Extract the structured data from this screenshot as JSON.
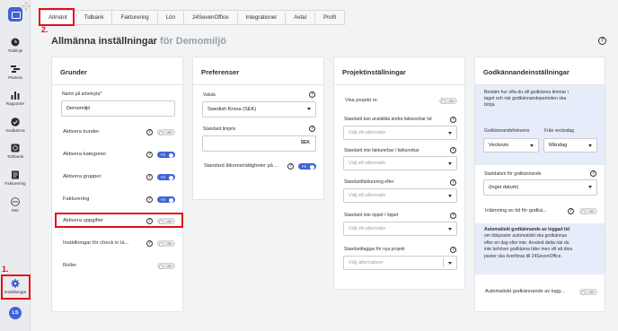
{
  "sidebar": {
    "items": [
      {
        "label": "Tidslinje",
        "icon": "clock-icon"
      },
      {
        "label": "Planera",
        "icon": "planning-icon"
      },
      {
        "label": "Rapporter",
        "icon": "bar-chart-icon"
      },
      {
        "label": "Godkänna",
        "icon": "check-circle-icon"
      },
      {
        "label": "Tidsbank",
        "icon": "timebank-icon"
      },
      {
        "label": "Fakturering",
        "icon": "invoice-icon"
      },
      {
        "label": "Mer",
        "icon": "more-icon"
      }
    ],
    "settings_label": "Inställningar",
    "avatar": "LS"
  },
  "tabs": [
    "Allmänt",
    "Tidbank",
    "Fakturering",
    "Lön",
    "24SevenOffice",
    "Integrationer",
    "Avtal",
    "Profil"
  ],
  "annotations": {
    "one": "1.",
    "two": "2."
  },
  "page": {
    "title": "Allmänna inställningar",
    "subtitle": "för Demomiljö"
  },
  "grunder": {
    "title": "Grunder",
    "workspace_label": "Namn på arbetsyta*",
    "workspace_value": "Demomiljö",
    "rows": [
      {
        "label": "Aktivera kunder",
        "state": "AV",
        "on": false
      },
      {
        "label": "Aktivera kategorier",
        "state": "PÅ",
        "on": true
      },
      {
        "label": "Aktivera grupper",
        "state": "PÅ",
        "on": true
      },
      {
        "label": "Fakturering",
        "state": "PÅ",
        "on": true
      },
      {
        "label": "Aktivera uppgifter",
        "state": "AV",
        "on": false
      },
      {
        "label": "Inställningar för check in lä...",
        "state": "AV",
        "on": false
      },
      {
        "label": "Roller",
        "state": "AV",
        "on": false
      }
    ]
  },
  "preferenser": {
    "title": "Preferenser",
    "currency_label": "Valuta",
    "currency_value": "Swedish Krona (SEK)",
    "rate_label": "Standard timpris",
    "rate_unit": "SEK",
    "rights_label": "Standard åtkomsträttigheter på ...",
    "rights_state": "PÅ"
  },
  "projekt": {
    "title": "Projektinställningar",
    "show_nr_label": "Visa projekt nr.",
    "show_nr_state": "AV",
    "fields": [
      {
        "label": "Standard kan anställda ändra fakturerbar tid",
        "placeholder": "Välj ett alternativ"
      },
      {
        "label": "Standard inte fakturerbar / fakturerbar",
        "placeholder": "Välj ett alternativ"
      },
      {
        "label": "Standardfakturering efter",
        "placeholder": "Välj ett alternativ"
      },
      {
        "label": "Standard inte öppet / öppet",
        "placeholder": "Välj ett alternativ"
      },
      {
        "label": "Standardtaggar för nya projekt",
        "placeholder": "Välj alternativer"
      }
    ]
  },
  "godkann": {
    "title": "Godkännandeinställningar",
    "intro": [
      "Bestäm hur ofta du vill godkänna timmar i",
      "taget och när godkännandeperioden ska",
      "börja."
    ],
    "freq_label": "Godkännandefrekvens",
    "freq_value": "Veckovis",
    "weekday_label": "Från veckodag",
    "weekday_value": "Måndag",
    "start_label": "Startdatum för godkännande",
    "start_value": "(Inget datum)",
    "submit_label": "Inlämning av tid för godkä...",
    "submit_state": "AV",
    "auto_title": "Automatiskt godkännande av loggad tid",
    "auto_text": [
      "Automatiskt godkännande av loggad tid tiljer",
      "om tidsposter automatiskt ska godkännas",
      "efter en dag eller inte. Använd detta när du",
      "inte behöver godkänna tider men vill att dina",
      "poster ska överföras till 24SevenOffice."
    ],
    "auto_label": "Automatiskt godkännande av logg...",
    "auto_state": "AV"
  }
}
